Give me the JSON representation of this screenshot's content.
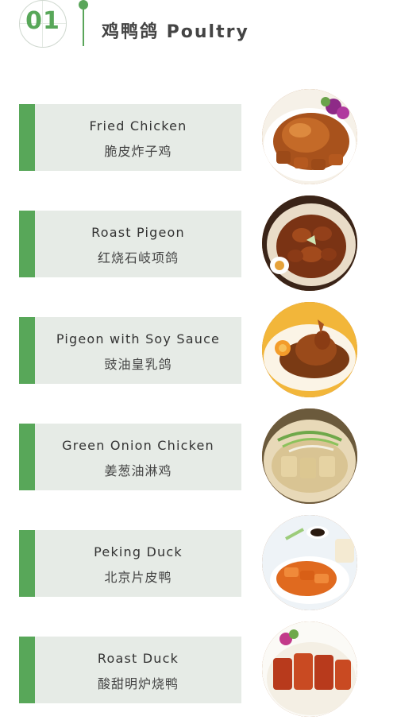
{
  "header": {
    "number": "01",
    "title": "鸡鸭鸽 Poultry"
  },
  "colors": {
    "accent": "#58a759",
    "card_bg": "#e6ebe6"
  },
  "items": [
    {
      "name_en": "Fried Chicken",
      "name_zh": "脆皮炸子鸡",
      "photo": "fried-chicken-photo"
    },
    {
      "name_en": "Roast Pigeon",
      "name_zh": "红烧石岐项鸽",
      "photo": "roast-pigeon-photo"
    },
    {
      "name_en": "Pigeon with Soy Sauce",
      "name_zh": "豉油皇乳鸽",
      "photo": "soy-pigeon-photo"
    },
    {
      "name_en": "Green Onion Chicken",
      "name_zh": "姜葱油淋鸡",
      "photo": "green-onion-chicken-photo"
    },
    {
      "name_en": "Peking Duck",
      "name_zh": "北京片皮鸭",
      "photo": "peking-duck-photo"
    },
    {
      "name_en": "Roast Duck",
      "name_zh": "酸甜明炉烧鸭",
      "photo": "roast-duck-photo"
    }
  ]
}
